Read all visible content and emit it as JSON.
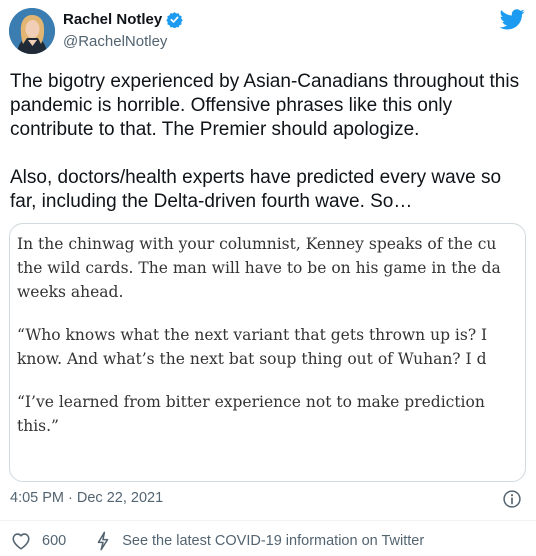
{
  "author": {
    "name": "Rachel Notley",
    "handle": "@RachelNotley",
    "verified": true
  },
  "tweet": {
    "paragraphs": [
      "The bigotry experienced by Asian-Canadians throughout this pandemic is horrible. Offensive phrases like this only contribute to that. The Premier should apologize.",
      "Also, doctors/health experts have predicted every wave so far, including the Delta-driven fourth wave. So…"
    ]
  },
  "quote_image": {
    "paragraphs": [
      [
        "In the chinwag with your columnist, Kenney speaks of the cu",
        "the wild cards. The man will have to be on his game in the da",
        "weeks ahead."
      ],
      [
        "“Who knows what the next variant that gets thrown up is? I",
        "know. And what’s the next bat soup thing out of Wuhan? I d"
      ],
      [
        "“I’ve learned from bitter experience not to make prediction",
        "this.”"
      ]
    ]
  },
  "meta": {
    "timestamp": "4:05 PM · Dec 22, 2021"
  },
  "actions": {
    "like_count": "600",
    "covid_info_label": "See the latest COVID-19 information on Twitter"
  },
  "icons": {
    "verified": "verified-badge-icon",
    "brand": "twitter-bird-icon",
    "info": "info-icon",
    "like": "heart-icon",
    "covid": "lightning-bolt-icon"
  },
  "colors": {
    "brand_blue": "#1d9bf0",
    "secondary_text": "#536471",
    "border": "#cfd9de"
  }
}
